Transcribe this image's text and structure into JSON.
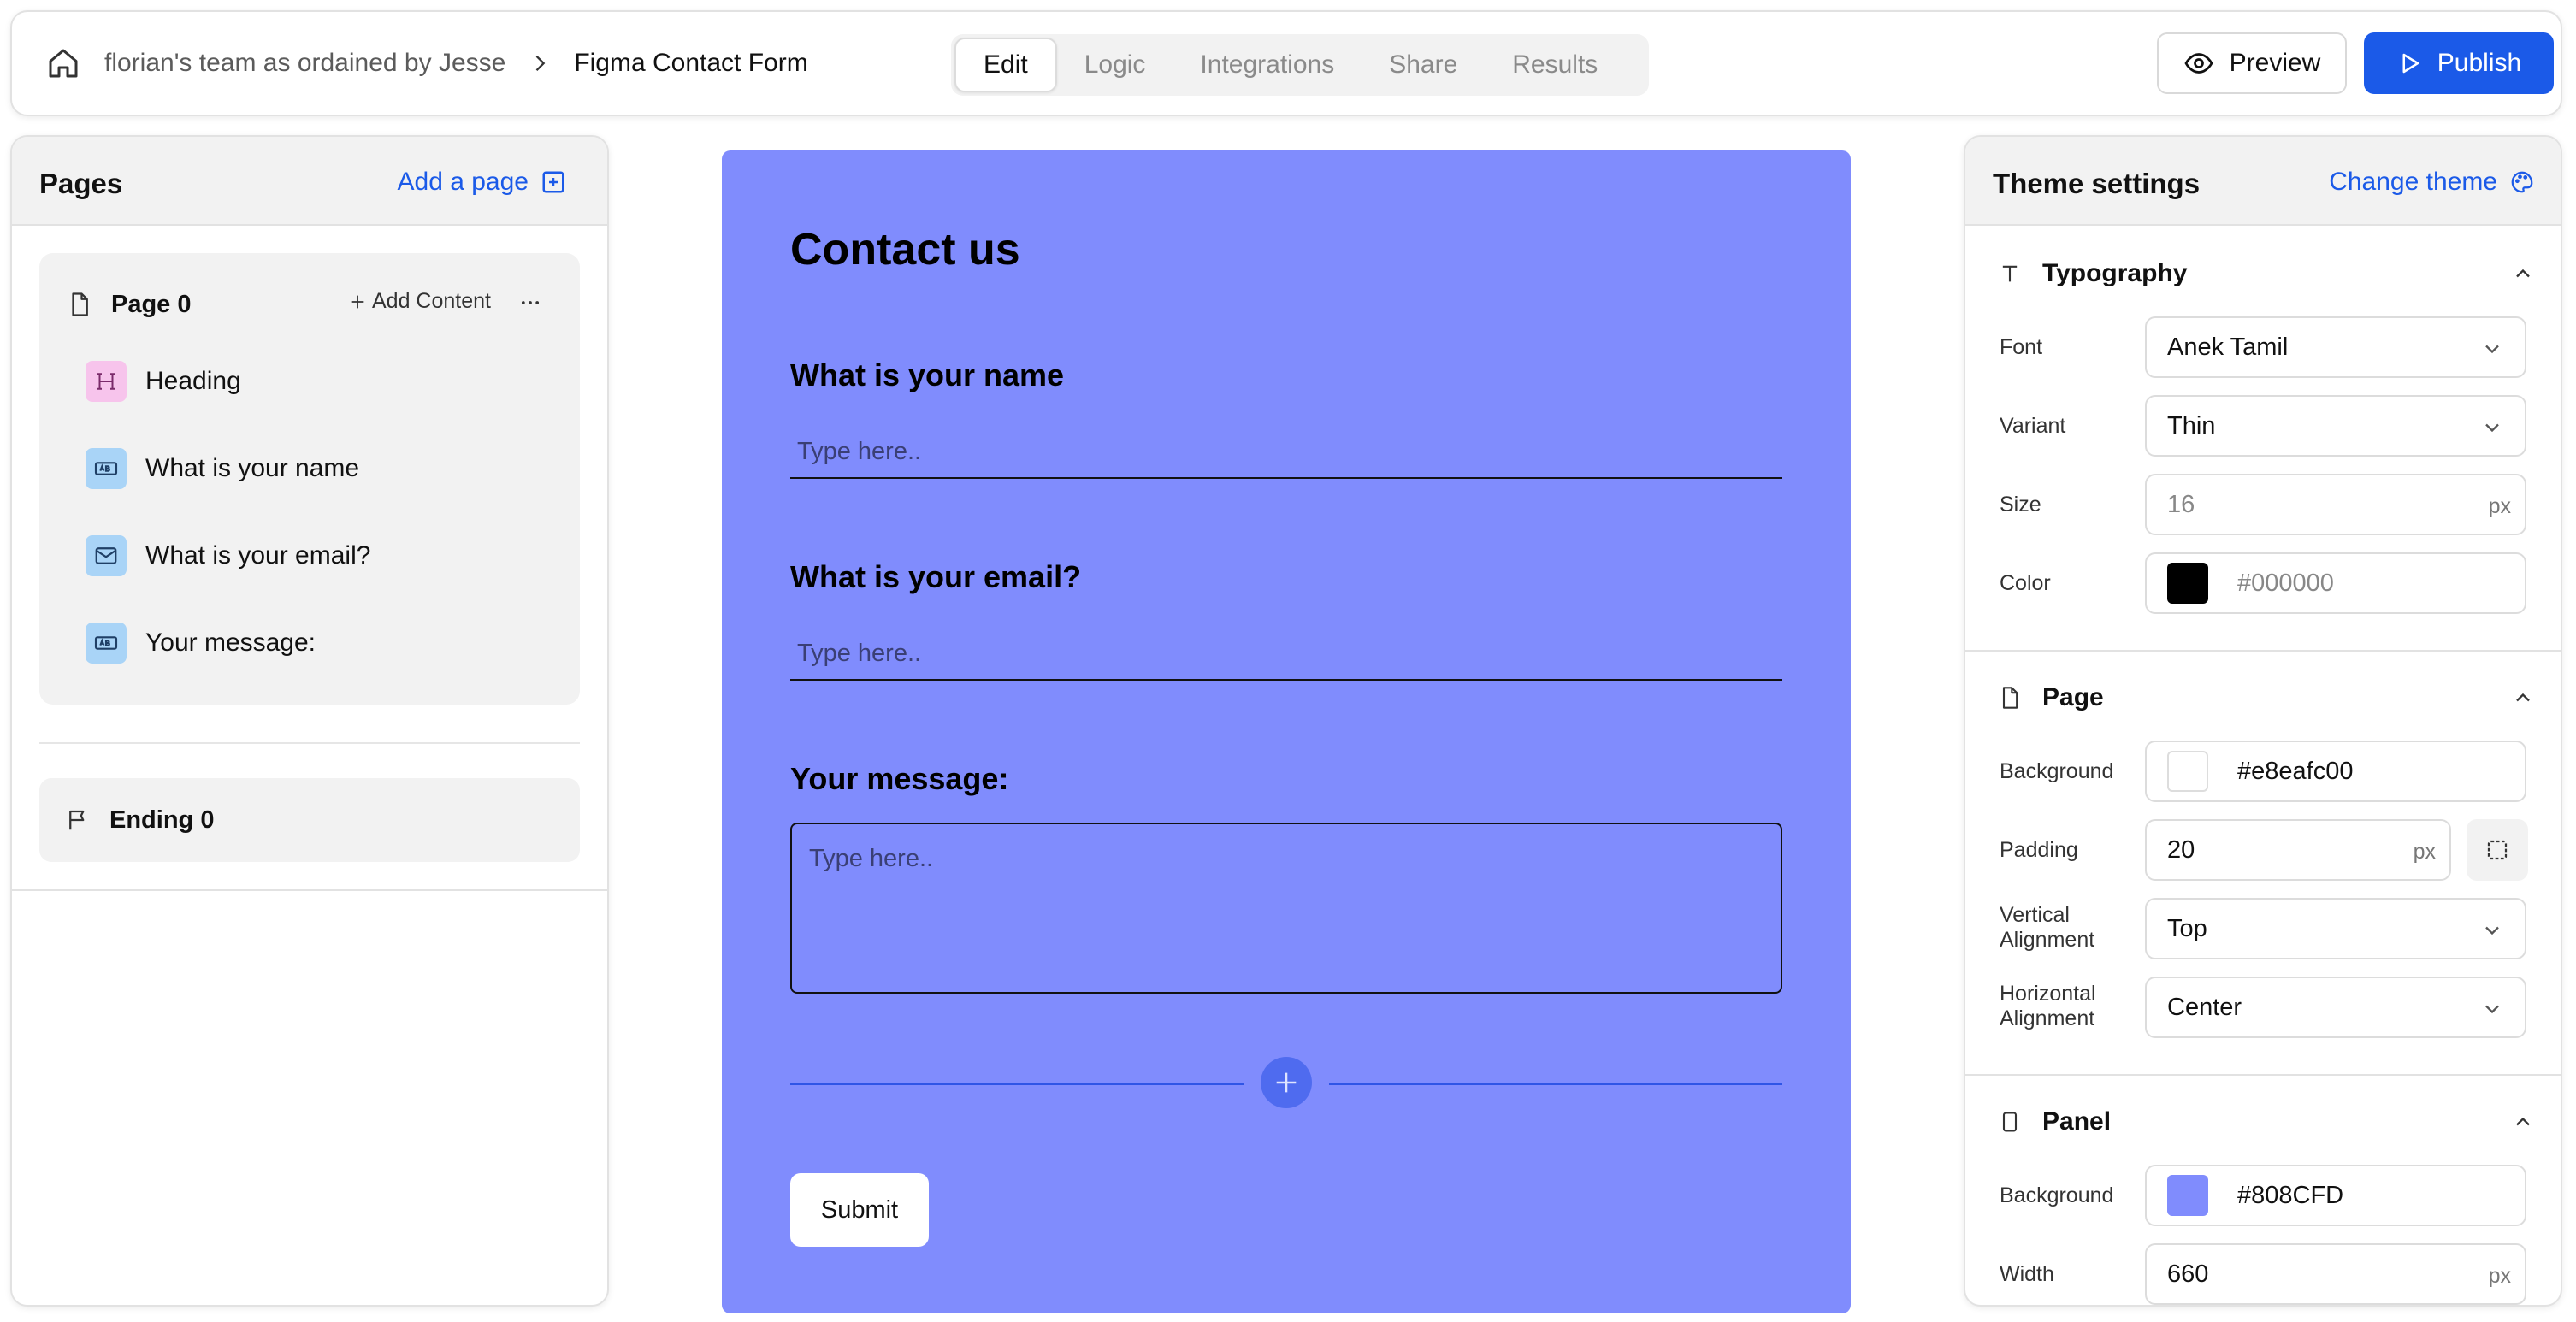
{
  "header": {
    "breadcrumb_team": "florian's team as ordained by Jesse",
    "breadcrumb_form": "Figma Contact Form",
    "tabs": [
      {
        "label": "Edit"
      },
      {
        "label": "Logic"
      },
      {
        "label": "Integrations"
      },
      {
        "label": "Share"
      },
      {
        "label": "Results"
      }
    ],
    "active_tab": "Edit",
    "preview_label": "Preview",
    "publish_label": "Publish"
  },
  "pages_panel": {
    "title": "Pages",
    "add_page_label": "Add a page",
    "page": {
      "name": "Page 0",
      "add_content_label": "Add Content",
      "items": [
        {
          "label": "Heading",
          "icon": "heading-icon"
        },
        {
          "label": "What is your name",
          "icon": "text-field-icon"
        },
        {
          "label": "What is your email?",
          "icon": "email-icon"
        },
        {
          "label": "Your message:",
          "icon": "text-field-icon"
        }
      ]
    },
    "ending": {
      "name": "Ending 0"
    }
  },
  "form": {
    "title": "Contact us",
    "questions": [
      {
        "label": "What is your name",
        "placeholder": "Type here.."
      },
      {
        "label": "What is your email?",
        "placeholder": "Type here.."
      },
      {
        "label": "Your message:",
        "placeholder": "Type here.."
      }
    ],
    "submit_label": "Submit",
    "panel_color": "#808cfd"
  },
  "theme": {
    "title": "Theme settings",
    "change_theme_label": "Change theme",
    "typography": {
      "title": "Typography",
      "font_label": "Font",
      "font_value": "Anek Tamil",
      "variant_label": "Variant",
      "variant_value": "Thin",
      "size_label": "Size",
      "size_value": "16",
      "size_unit": "px",
      "color_label": "Color",
      "color_value": "#000000"
    },
    "page": {
      "title": "Page",
      "background_label": "Background",
      "background_value": "#e8eafc00",
      "padding_label": "Padding",
      "padding_value": "20",
      "padding_unit": "px",
      "vertical_label_1": "Vertical",
      "vertical_label_2": "Alignment",
      "vertical_value": "Top",
      "horizontal_label_1": "Horizontal",
      "horizontal_label_2": "Alignment",
      "horizontal_value": "Center"
    },
    "panel": {
      "title": "Panel",
      "background_label": "Background",
      "background_value": "#808CFD",
      "width_label": "Width",
      "width_value": "660",
      "width_unit": "px"
    }
  },
  "colors": {
    "accent": "#1b5ae8",
    "heading_icon_bg": "#f7c4ec",
    "field_icon_bg": "#a9d4f7"
  }
}
